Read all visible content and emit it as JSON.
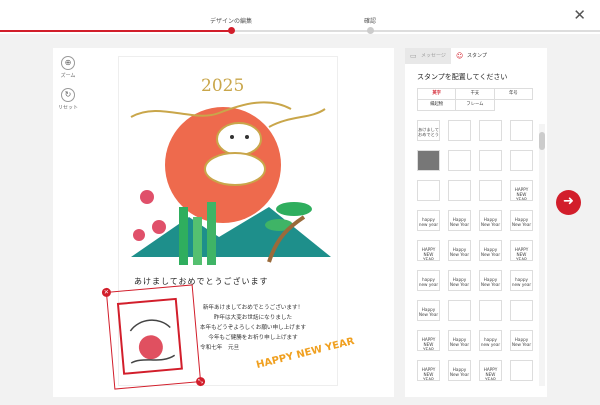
{
  "header": {
    "steps": [
      {
        "label": "デザインの編集",
        "active": true
      },
      {
        "label": "確認",
        "active": false
      }
    ]
  },
  "tools": {
    "zoom_label": "ズーム",
    "reset_label": "リセット"
  },
  "card": {
    "year": "2025",
    "greeting": "あけましておめでとうございます",
    "message_lines": [
      "新年あけましておめでとうございます！",
      "昨年は大変お世話になりました",
      "本年もどうぞよろしくお願い申し上げます",
      "今年もご健勝をお祈り申し上げます"
    ],
    "signature": "令和七年　元旦",
    "stamp_text": "HAPPY NEW YEAR"
  },
  "panel": {
    "tabs": [
      {
        "label": "メッセージ",
        "icon": "speech-bubble-icon",
        "active": false
      },
      {
        "label": "スタンプ",
        "icon": "smile-icon",
        "active": true
      }
    ],
    "title": "スタンプを配置してください",
    "categories": [
      "英字",
      "干支",
      "年号",
      "縁起物",
      "フレーム"
    ],
    "selected_category": "英字",
    "stamps": [
      "あけまして\nおめでとう",
      "",
      "",
      "",
      "",
      "",
      "",
      "",
      "",
      "",
      "",
      "HAPPY\nNEW YEAR",
      "happy new year",
      "Happy New Year",
      "Happy New Year",
      "Happy New Year",
      "HAPPY\nNEW YEAR",
      "Happy New Year",
      "Happy New Year",
      "HAPPY\nNEW YEAR",
      "happy new year",
      "Happy New Year",
      "Happy\nNew Year",
      "happy new year",
      "Happy\nNew Year",
      "",
      "",
      "",
      "HAPPY\nNEW YEAR",
      "Happy New Year",
      "happy new year",
      "Happy New Year",
      "HAPPY\nNEW YEAR",
      "Happy New Year",
      "HAPPY\nNEW YEAR",
      ""
    ]
  },
  "colors": {
    "accent": "#d21e2b",
    "sun": "#ee6a4d",
    "gold": "#c9a64a",
    "teal": "#26a49c"
  }
}
